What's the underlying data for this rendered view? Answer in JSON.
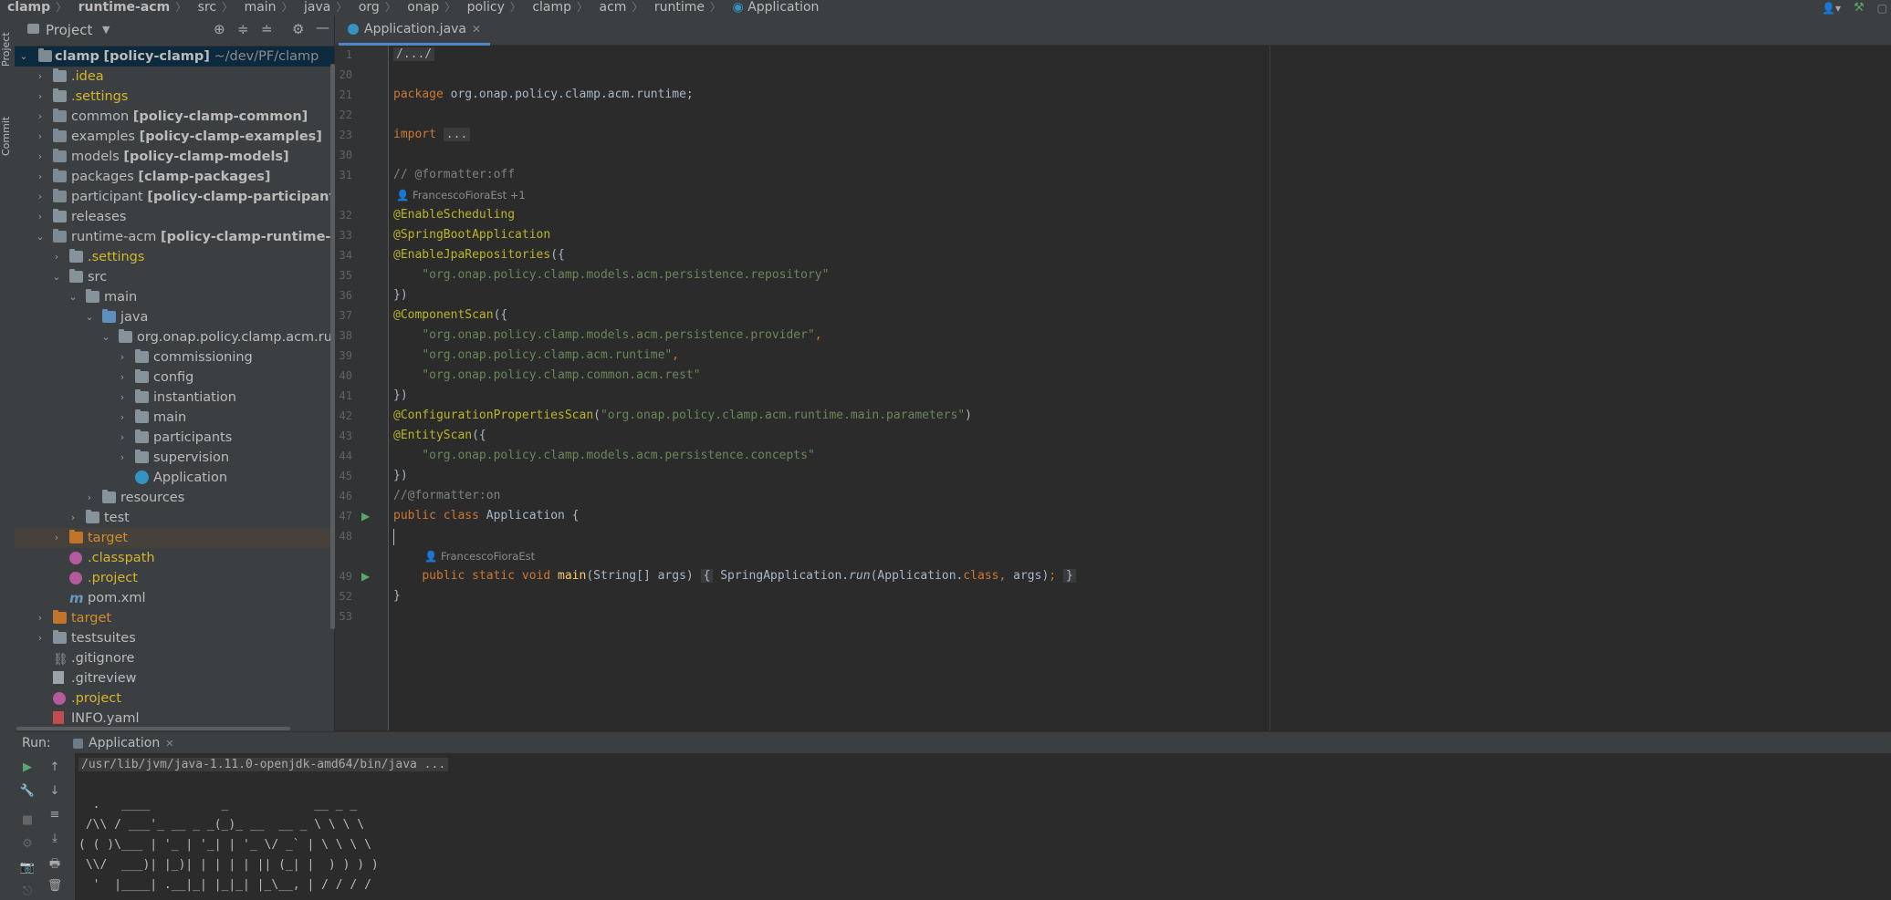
{
  "breadcrumb": [
    "clamp",
    "runtime-acm",
    "src",
    "main",
    "java",
    "org",
    "onap",
    "policy",
    "clamp",
    "acm",
    "runtime",
    "Application"
  ],
  "project_panel": {
    "title": "Project",
    "tree": [
      {
        "label": "clamp",
        "module": "[policy-clamp]",
        "path": "~/dev/PF/clamp"
      },
      {
        "label": ".idea"
      },
      {
        "label": ".settings"
      },
      {
        "label": "common",
        "module": "[policy-clamp-common]"
      },
      {
        "label": "examples",
        "module": "[policy-clamp-examples]"
      },
      {
        "label": "models",
        "module": "[policy-clamp-models]"
      },
      {
        "label": "packages",
        "module": "[clamp-packages]"
      },
      {
        "label": "participant",
        "module": "[policy-clamp-participant]"
      },
      {
        "label": "releases"
      },
      {
        "label": "runtime-acm",
        "module": "[policy-clamp-runtime-acm]"
      },
      {
        "label": ".settings"
      },
      {
        "label": "src"
      },
      {
        "label": "main"
      },
      {
        "label": "java"
      },
      {
        "label": "org.onap.policy.clamp.acm.runti"
      },
      {
        "label": "commissioning"
      },
      {
        "label": "config"
      },
      {
        "label": "instantiation"
      },
      {
        "label": "main"
      },
      {
        "label": "participants"
      },
      {
        "label": "supervision"
      },
      {
        "label": "Application"
      },
      {
        "label": "resources"
      },
      {
        "label": "test"
      },
      {
        "label": "target"
      },
      {
        "label": ".classpath"
      },
      {
        "label": ".project"
      },
      {
        "label": "pom.xml"
      },
      {
        "label": "target"
      },
      {
        "label": "testsuites"
      },
      {
        "label": ".gitignore"
      },
      {
        "label": ".gitreview"
      },
      {
        "label": ".project"
      },
      {
        "label": "INFO.yaml"
      }
    ]
  },
  "left_strip": {
    "project": "Project",
    "commit": "Commit"
  },
  "editor": {
    "tab": "Application.java",
    "hint_author": "FrancescoFioraEst +1",
    "hint_author2": "FrancescoFioraEst",
    "lines": [
      {
        "n": "1",
        "t": "/.../"
      },
      {
        "n": "20",
        "t": ""
      },
      {
        "n": "21",
        "t": "package org.onap.policy.clamp.acm.runtime;"
      },
      {
        "n": "22",
        "t": ""
      },
      {
        "n": "23",
        "t": "import ..."
      },
      {
        "n": "30",
        "t": ""
      },
      {
        "n": "31",
        "t": "// @formatter:off"
      },
      {
        "n": "32",
        "t": "@EnableScheduling"
      },
      {
        "n": "33",
        "t": "@SpringBootApplication"
      },
      {
        "n": "34",
        "t": "@EnableJpaRepositories({"
      },
      {
        "n": "35",
        "t": "    \"org.onap.policy.clamp.models.acm.persistence.repository\""
      },
      {
        "n": "36",
        "t": "})"
      },
      {
        "n": "37",
        "t": "@ComponentScan({"
      },
      {
        "n": "38",
        "t": "    \"org.onap.policy.clamp.models.acm.persistence.provider\","
      },
      {
        "n": "39",
        "t": "    \"org.onap.policy.clamp.acm.runtime\","
      },
      {
        "n": "40",
        "t": "    \"org.onap.policy.clamp.common.acm.rest\""
      },
      {
        "n": "41",
        "t": "})"
      },
      {
        "n": "42",
        "t": "@ConfigurationPropertiesScan(\"org.onap.policy.clamp.acm.runtime.main.parameters\")"
      },
      {
        "n": "43",
        "t": "@EntityScan({"
      },
      {
        "n": "44",
        "t": "    \"org.onap.policy.clamp.models.acm.persistence.concepts\""
      },
      {
        "n": "45",
        "t": "})"
      },
      {
        "n": "46",
        "t": "//@formatter:on"
      },
      {
        "n": "47",
        "t": "public class Application {"
      },
      {
        "n": "48",
        "t": ""
      },
      {
        "n": "49",
        "t": "    public static void main(String[] args) { SpringApplication.run(Application.class, args); }"
      },
      {
        "n": "52",
        "t": "}"
      },
      {
        "n": "53",
        "t": ""
      }
    ]
  },
  "run_panel": {
    "label": "Run:",
    "tab": "Application",
    "console": [
      "/usr/lib/jvm/java-1.11.0-openjdk-amd64/bin/java ...",
      "",
      "  .   ____          _            __ _ _",
      " /\\\\ / ___'_ __ _ _(_)_ __  __ _ \\ \\ \\ \\",
      "( ( )\\___ | '_ | '_| | '_ \\/ _` | \\ \\ \\ \\",
      " \\\\/  ___)| |_)| | | | | || (_| |  ) ) ) )",
      "  '  |____| .__|_| |_|_| |_\\__, | / / / /"
    ]
  },
  "colors": {
    "bg": "#2b2b2b",
    "panel": "#3c3f41",
    "keyword": "#cc7832",
    "annotation": "#bbb529",
    "string": "#6a8759",
    "comment": "#808080"
  }
}
